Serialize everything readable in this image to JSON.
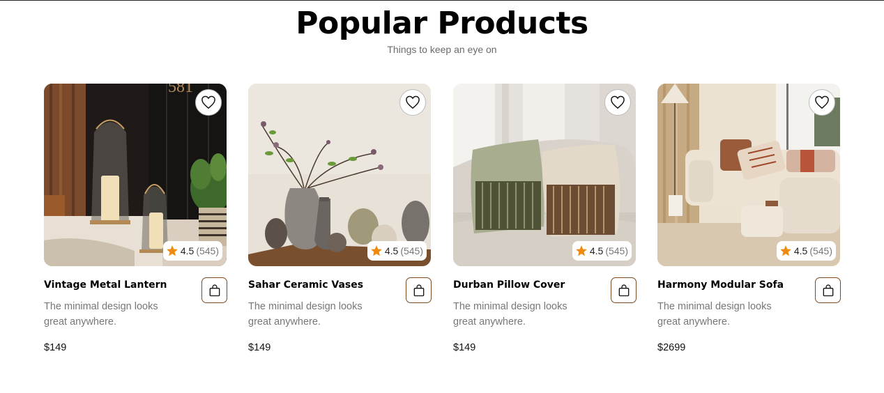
{
  "section": {
    "title": "Popular Products",
    "subtitle": "Things to keep an eye on"
  },
  "colors": {
    "accent_star": "#f08a0e",
    "cart_border": "#7a4a1e"
  },
  "icons": {
    "wishlist": "heart-icon",
    "rating": "star-icon",
    "cart": "shopping-bag-icon"
  },
  "products": [
    {
      "name": "Vintage Metal Lantern",
      "description": "The minimal design looks great anywhere.",
      "price": "$149",
      "rating": "4.5",
      "reviews": "(545)"
    },
    {
      "name": "Sahar Ceramic Vases",
      "description": "The minimal design looks great anywhere.",
      "price": "$149",
      "rating": "4.5",
      "reviews": "(545)"
    },
    {
      "name": "Durban Pillow Cover",
      "description": "The minimal design looks great anywhere.",
      "price": "$149",
      "rating": "4.5",
      "reviews": "(545)"
    },
    {
      "name": "Harmony Modular Sofa",
      "description": "The minimal design looks great anywhere.",
      "price": "$2699",
      "rating": "4.5",
      "reviews": "(545)"
    }
  ]
}
